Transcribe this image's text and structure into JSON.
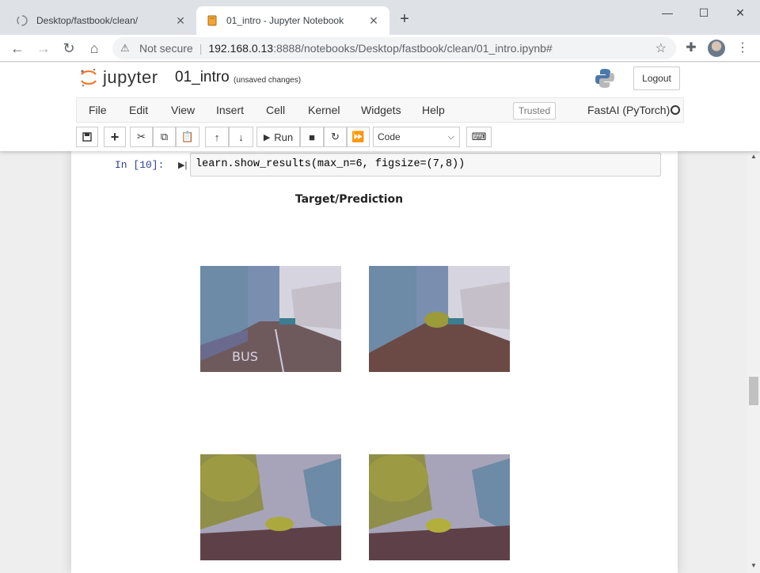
{
  "browser": {
    "tabs": [
      {
        "title": "Desktop/fastbook/clean/",
        "active": false
      },
      {
        "title": "01_intro - Jupyter Notebook",
        "active": true
      }
    ],
    "address": {
      "security_label": "Not secure",
      "host": "192.168.0.13",
      "path": ":8888/notebooks/Desktop/fastbook/clean/01_intro.ipynb#"
    }
  },
  "jupyter": {
    "logo_text": "jupyter",
    "notebook_name": "01_intro",
    "save_status": "(unsaved changes)",
    "logout_label": "Logout",
    "menu": [
      "File",
      "Edit",
      "View",
      "Insert",
      "Cell",
      "Kernel",
      "Widgets",
      "Help"
    ],
    "trusted_label": "Trusted",
    "kernel_name": "FastAI (PyTorch)",
    "toolbar": {
      "run_label": "Run",
      "cell_type": "Code"
    }
  },
  "cell": {
    "prompt": "In [10]:",
    "code": "learn.show_results(max_n=6, figsize=(7,8))",
    "output_title": "Target/Prediction"
  },
  "colors": {
    "notebook_bg": "#eeeeee",
    "prompt_color": "#303f9f"
  }
}
